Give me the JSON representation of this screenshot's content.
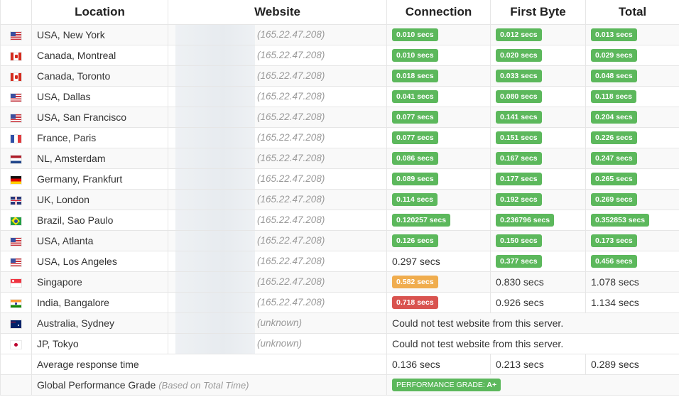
{
  "headers": [
    "",
    "Location",
    "Website",
    "Connection",
    "First Byte",
    "Total"
  ],
  "rows": [
    {
      "flag": "us-flag-icon",
      "location": "USA, New York",
      "ip": "(165.22.47.208)",
      "conn": "0.010 secs",
      "conn_style": "green",
      "fb": "0.012 secs",
      "fb_style": "green",
      "total": "0.013 secs",
      "total_style": "green"
    },
    {
      "flag": "ca-flag-icon",
      "location": "Canada, Montreal",
      "ip": "(165.22.47.208)",
      "conn": "0.010 secs",
      "conn_style": "green",
      "fb": "0.020 secs",
      "fb_style": "green",
      "total": "0.029 secs",
      "total_style": "green"
    },
    {
      "flag": "ca-flag-icon",
      "location": "Canada, Toronto",
      "ip": "(165.22.47.208)",
      "conn": "0.018 secs",
      "conn_style": "green",
      "fb": "0.033 secs",
      "fb_style": "green",
      "total": "0.048 secs",
      "total_style": "green"
    },
    {
      "flag": "us-flag-icon",
      "location": "USA, Dallas",
      "ip": "(165.22.47.208)",
      "conn": "0.041 secs",
      "conn_style": "green",
      "fb": "0.080 secs",
      "fb_style": "green",
      "total": "0.118 secs",
      "total_style": "green"
    },
    {
      "flag": "us-flag-icon",
      "location": "USA, San Francisco",
      "ip": "(165.22.47.208)",
      "conn": "0.077 secs",
      "conn_style": "green",
      "fb": "0.141 secs",
      "fb_style": "green",
      "total": "0.204 secs",
      "total_style": "green"
    },
    {
      "flag": "fr-flag-icon",
      "location": "France, Paris",
      "ip": "(165.22.47.208)",
      "conn": "0.077 secs",
      "conn_style": "green",
      "fb": "0.151 secs",
      "fb_style": "green",
      "total": "0.226 secs",
      "total_style": "green"
    },
    {
      "flag": "nl-flag-icon",
      "location": "NL, Amsterdam",
      "ip": "(165.22.47.208)",
      "conn": "0.086 secs",
      "conn_style": "green",
      "fb": "0.167 secs",
      "fb_style": "green",
      "total": "0.247 secs",
      "total_style": "green"
    },
    {
      "flag": "de-flag-icon",
      "location": "Germany, Frankfurt",
      "ip": "(165.22.47.208)",
      "conn": "0.089 secs",
      "conn_style": "green",
      "fb": "0.177 secs",
      "fb_style": "green",
      "total": "0.265 secs",
      "total_style": "green"
    },
    {
      "flag": "uk-flag-icon",
      "location": "UK, London",
      "ip": "(165.22.47.208)",
      "conn": "0.114 secs",
      "conn_style": "green",
      "fb": "0.192 secs",
      "fb_style": "green",
      "total": "0.269 secs",
      "total_style": "green"
    },
    {
      "flag": "br-flag-icon",
      "location": "Brazil, Sao Paulo",
      "ip": "(165.22.47.208)",
      "conn": "0.120257 secs",
      "conn_style": "green",
      "fb": "0.236796 secs",
      "fb_style": "green",
      "total": "0.352853 secs",
      "total_style": "green"
    },
    {
      "flag": "us-flag-icon",
      "location": "USA, Atlanta",
      "ip": "(165.22.47.208)",
      "conn": "0.126 secs",
      "conn_style": "green",
      "fb": "0.150 secs",
      "fb_style": "green",
      "total": "0.173 secs",
      "total_style": "green"
    },
    {
      "flag": "us-flag-icon",
      "location": "USA, Los Angeles",
      "ip": "(165.22.47.208)",
      "conn": "0.297 secs",
      "conn_style": "plain",
      "fb": "0.377 secs",
      "fb_style": "green",
      "total": "0.456 secs",
      "total_style": "green"
    },
    {
      "flag": "sg-flag-icon",
      "location": "Singapore",
      "ip": "(165.22.47.208)",
      "conn": "0.582 secs",
      "conn_style": "orange",
      "fb": "0.830 secs",
      "fb_style": "plain",
      "total": "1.078 secs",
      "total_style": "plain"
    },
    {
      "flag": "in-flag-icon",
      "location": "India, Bangalore",
      "ip": "(165.22.47.208)",
      "conn": "0.718 secs",
      "conn_style": "red",
      "fb": "0.926 secs",
      "fb_style": "plain",
      "total": "1.134 secs",
      "total_style": "plain"
    },
    {
      "flag": "au-flag-icon",
      "location": "Australia, Sydney",
      "ip": "(unknown)",
      "error": "Could not test website from this server."
    },
    {
      "flag": "jp-flag-icon",
      "location": "JP, Tokyo",
      "ip": "(unknown)",
      "error": "Could not test website from this server."
    }
  ],
  "summary": {
    "avg_label": "Average response time",
    "avg_conn": "0.136 secs",
    "avg_fb": "0.213 secs",
    "avg_total": "0.289 secs",
    "grade_label": "Global Performance Grade",
    "grade_note": "(Based on Total Time)",
    "grade_badge_prefix": "PERFORMANCE GRADE:",
    "grade_value": "A+"
  },
  "colors": {
    "green": "#5cb85c",
    "orange": "#f0ad4e",
    "red": "#d9534f"
  }
}
